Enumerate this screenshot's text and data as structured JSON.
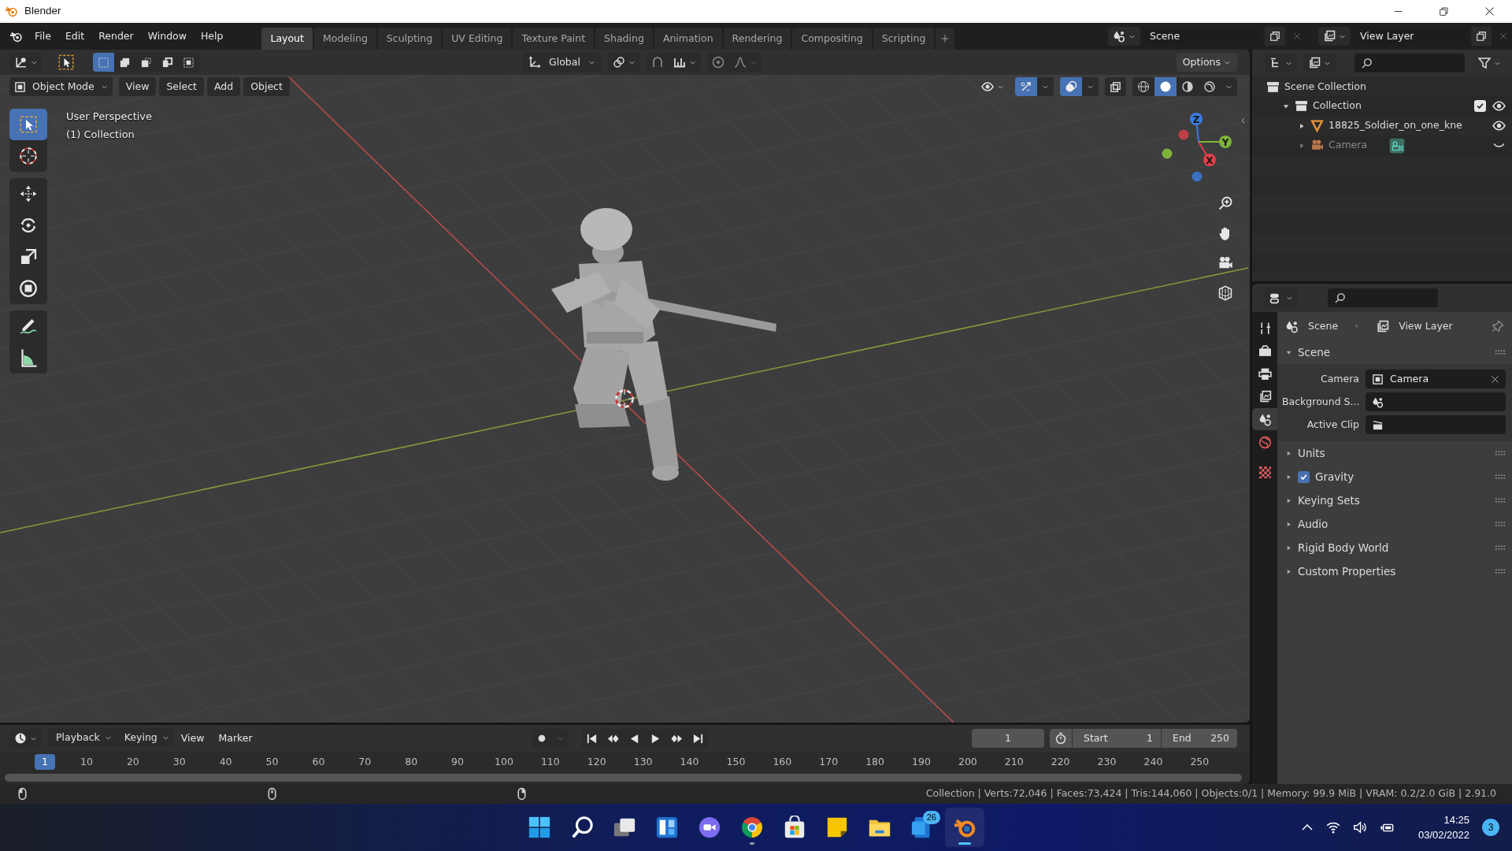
{
  "window": {
    "title": "Blender"
  },
  "menu": [
    "File",
    "Edit",
    "Render",
    "Window",
    "Help"
  ],
  "workspaces": [
    {
      "label": "Layout",
      "selected": true
    },
    {
      "label": "Modeling",
      "selected": false
    },
    {
      "label": "Sculpting",
      "selected": false
    },
    {
      "label": "UV Editing",
      "selected": false
    },
    {
      "label": "Texture Paint",
      "selected": false
    },
    {
      "label": "Shading",
      "selected": false
    },
    {
      "label": "Animation",
      "selected": false
    },
    {
      "label": "Rendering",
      "selected": false
    },
    {
      "label": "Compositing",
      "selected": false
    },
    {
      "label": "Scripting",
      "selected": false
    }
  ],
  "scene": {
    "name": "Scene"
  },
  "view_layer": {
    "name": "View Layer"
  },
  "viewport": {
    "select_modes": [
      {
        "kind": "set",
        "selected": true
      },
      {
        "kind": "extend",
        "selected": false
      },
      {
        "kind": "subtract",
        "selected": false
      },
      {
        "kind": "invert",
        "selected": false
      },
      {
        "kind": "intersect",
        "selected": false
      }
    ],
    "orientation": "Global",
    "snap": false,
    "proportional": false,
    "options": "Options",
    "mode": "Object Mode",
    "menus": [
      "View",
      "Select",
      "Add",
      "Object"
    ],
    "show_gizmos": true,
    "show_overlays": true,
    "xray": false,
    "shading": [
      {
        "kind": "wireframe",
        "selected": false
      },
      {
        "kind": "solid",
        "selected": true
      },
      {
        "kind": "material",
        "selected": false
      },
      {
        "kind": "rendered",
        "selected": false
      }
    ],
    "overlay_text": [
      "User Perspective",
      "(1) Collection"
    ],
    "tool_groups": [
      [
        {
          "kind": "select_box",
          "selected": true
        },
        {
          "kind": "cursor",
          "selected": false
        }
      ],
      [
        {
          "kind": "move",
          "selected": false
        },
        {
          "kind": "rotate",
          "selected": false
        },
        {
          "kind": "scale",
          "selected": false
        },
        {
          "kind": "transform",
          "selected": false
        }
      ],
      [
        {
          "kind": "annotate",
          "selected": false
        },
        {
          "kind": "measure",
          "selected": false
        }
      ]
    ],
    "gizmo": {
      "x": "X",
      "y": "Y",
      "z": "Z"
    }
  },
  "outliner": {
    "items": [
      {
        "label": "Scene Collection",
        "kind": "collection",
        "children": [
          {
            "label": "Collection",
            "kind": "collection",
            "expanded": true,
            "checked": true,
            "visible": true,
            "children": [
              {
                "label": "18825_Soldier_on_one_kne",
                "kind": "mesh",
                "expanded": false,
                "visible": true
              },
              {
                "label": "Camera",
                "kind": "camera",
                "expanded": false,
                "visible": false
              }
            ]
          }
        ]
      }
    ]
  },
  "properties": {
    "tabs": [
      [
        {
          "kind": "tool",
          "selected": false
        },
        {
          "kind": "render",
          "selected": false
        },
        {
          "kind": "output",
          "selected": false
        },
        {
          "kind": "view_layer",
          "selected": false
        },
        {
          "kind": "scene",
          "selected": true
        },
        {
          "kind": "world",
          "selected": false
        }
      ],
      [
        {
          "kind": "texture",
          "selected": false
        }
      ]
    ],
    "breadcrumb": [
      "Scene",
      "View Layer"
    ],
    "panels": [
      {
        "label": "Scene",
        "expanded": true,
        "fields": [
          {
            "label": "Camera",
            "kind": "object",
            "value": "Camera"
          },
          {
            "label": "Background S...",
            "kind": "scene"
          },
          {
            "label": "Active Clip",
            "kind": "clip"
          }
        ]
      },
      {
        "label": "Units",
        "expanded": false
      },
      {
        "label": "Gravity",
        "expanded": false,
        "checked": true
      },
      {
        "label": "Keying Sets",
        "expanded": false
      },
      {
        "label": "Audio",
        "expanded": false
      },
      {
        "label": "Rigid Body World",
        "expanded": false
      },
      {
        "label": "Custom Properties",
        "expanded": false
      }
    ]
  },
  "timeline": {
    "menus": [
      {
        "label": "Playback",
        "kind": "dropdown"
      },
      {
        "label": "Keying",
        "kind": "dropdown"
      },
      {
        "label": "View",
        "kind": "menu"
      },
      {
        "label": "Marker",
        "kind": "menu"
      }
    ],
    "auto_keying": false,
    "current_frame": "1",
    "start_label": "Start",
    "start": "1",
    "end_label": "End",
    "end": "250",
    "frame_marker": "1",
    "ruler": [
      "10",
      "20",
      "30",
      "40",
      "50",
      "60",
      "70",
      "80",
      "90",
      "100",
      "110",
      "120",
      "130",
      "140",
      "150",
      "160",
      "170",
      "180",
      "190",
      "200",
      "210",
      "220",
      "230",
      "240",
      "250"
    ]
  },
  "status_bar": {
    "text": "Collection | Verts:72,046 | Faces:73,424 | Tris:144,060 | Objects:0/1 | Memory: 99.9 MiB | VRAM: 0.2/2.0 GiB | 2.91.0"
  },
  "taskbar": {
    "apps": [
      {
        "kind": "start",
        "selected": false,
        "running": false
      },
      {
        "kind": "search",
        "selected": false,
        "running": false
      },
      {
        "kind": "taskview",
        "selected": false,
        "running": false
      },
      {
        "kind": "widgets",
        "selected": false,
        "running": false
      },
      {
        "kind": "chat",
        "selected": false,
        "running": false
      },
      {
        "kind": "chrome",
        "selected": false,
        "running": true
      },
      {
        "kind": "store",
        "selected": false,
        "running": false
      },
      {
        "kind": "notes",
        "selected": false,
        "running": false
      },
      {
        "kind": "explorer",
        "selected": false,
        "running": false
      },
      {
        "kind": "mail",
        "selected": false,
        "running": false,
        "badge": "26"
      },
      {
        "kind": "blender",
        "selected": true,
        "running": true
      }
    ],
    "time": "14:25",
    "date": "03/02/2022",
    "notifications": "3"
  }
}
